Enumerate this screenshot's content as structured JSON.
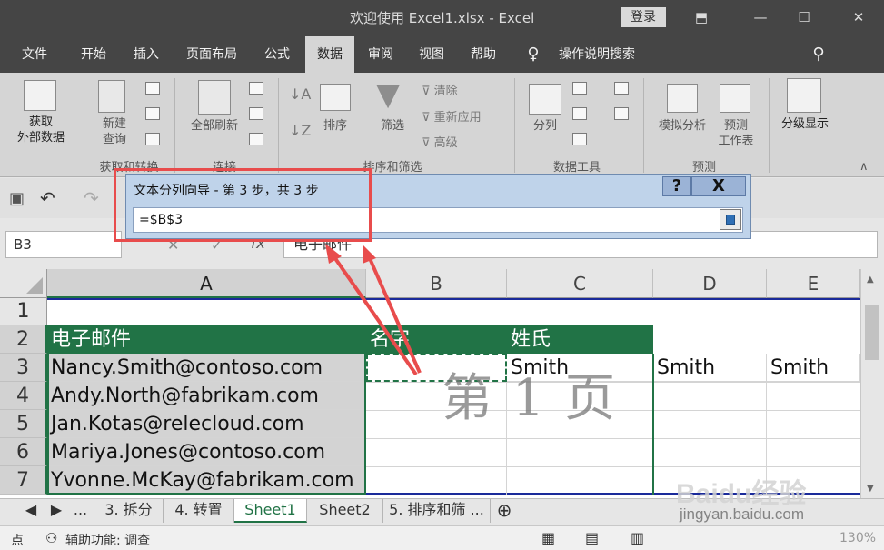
{
  "window": {
    "title": "欢迎使用 Excel1.xlsx  -  Excel",
    "login": "登录"
  },
  "tabs": [
    "文件",
    "开始",
    "插入",
    "页面布局",
    "公式",
    "数据",
    "审阅",
    "视图",
    "帮助",
    "操作说明搜索"
  ],
  "ribbon": {
    "get_data": "获取\n外部数据",
    "new_query": "新建\n查询",
    "refresh_all": "全部刷新",
    "sort": "排序",
    "filter": "筛选",
    "clear": "清除",
    "reapply": "重新应用",
    "advanced": "高级",
    "split": "分列",
    "whatif": "模拟分析",
    "forecast_sheet": "预测\n工作表",
    "outline": "分级显示",
    "groups": {
      "get_transform": "获取和转换",
      "connections": "连接",
      "sort_filter": "排序和筛选",
      "data_tools": "数据工具",
      "forecast": "预测"
    }
  },
  "formula_bar": {
    "name_box": "B3",
    "fx": "fx",
    "formula": "电子邮件"
  },
  "dialog": {
    "title": "文本分列向导 - 第 3 步，共 3 步",
    "help": "?",
    "close": "X",
    "value": "=$B$3"
  },
  "columns": [
    "A",
    "B",
    "C",
    "D",
    "E"
  ],
  "rows": [
    "1",
    "2",
    "3",
    "4",
    "5",
    "6",
    "7"
  ],
  "cells": {
    "A2": "电子邮件",
    "B2": "名字",
    "C2": "姓氏",
    "A3": "Nancy.Smith@contoso.com",
    "C3": "Smith",
    "D3": "Smith",
    "E3": "Smith",
    "A4": "Andy.North@fabrikam.com",
    "A5": "Jan.Kotas@relecloud.com",
    "A6": "Mariya.Jones@contoso.com",
    "A7": "Yvonne.McKay@fabrikam.com"
  },
  "page_watermark": "第 1 页",
  "sheet_tabs": [
    "...",
    "3. 拆分",
    "4. 转置",
    "Sheet1",
    "Sheet2",
    "5. 排序和筛 ..."
  ],
  "status": {
    "mode": "点",
    "accessibility": "辅助功能: 调查",
    "zoom": "130%"
  },
  "watermark": {
    "brand": "Baidu经验",
    "url": "jingyan.baidu.com"
  }
}
